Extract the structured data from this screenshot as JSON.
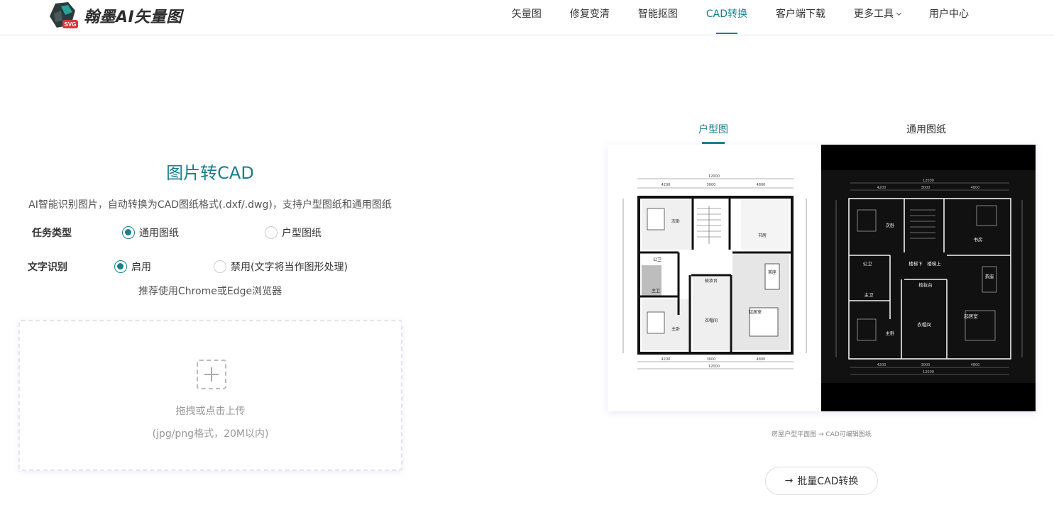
{
  "header": {
    "brand": "翰墨AI矢量图",
    "badge": "SVG",
    "nav": [
      {
        "label": "矢量图"
      },
      {
        "label": "修复变清"
      },
      {
        "label": "智能抠图"
      },
      {
        "label": "CAD转换",
        "active": true
      },
      {
        "label": "客户端下载"
      },
      {
        "label": "更多工具",
        "dropdown": true
      },
      {
        "label": "用户中心"
      }
    ]
  },
  "main": {
    "title": "图片转CAD",
    "description": "AI智能识别图片，自动转换为CAD图纸格式(.dxf/.dwg)，支持户型图纸和通用图纸",
    "task_type": {
      "label": "任务类型",
      "options": [
        "通用图纸",
        "户型图纸"
      ],
      "selected": "通用图纸"
    },
    "text_recognition": {
      "label": "文字识别",
      "options": [
        "启用",
        "禁用(文字将当作图形处理)"
      ],
      "selected": "启用"
    },
    "browser_tip": "推荐使用Chrome或Edge浏览器",
    "upload": {
      "line1": "拖拽或点击上传",
      "line2": "(jpg/png格式，20M以内)"
    }
  },
  "preview": {
    "tabs": [
      {
        "label": "户型图",
        "active": true
      },
      {
        "label": "通用图纸"
      }
    ],
    "plan": {
      "dims_top": [
        "12000",
        "4200",
        "3000",
        "4800"
      ],
      "dims_bottom": [
        "4200",
        "3000",
        "4800",
        "12000"
      ],
      "rooms_light": [
        "次卧",
        "书房",
        "公卫",
        "主卫",
        "梳妆台",
        "茶座",
        "衣帽间",
        "起居室",
        "主卧"
      ],
      "rooms_dark": [
        "次卧",
        "书房",
        "公卫",
        "楼梯下",
        "楼梯上",
        "茶座",
        "主卫",
        "梳妆台",
        "衣帽间",
        "起居室",
        "主卧"
      ]
    },
    "caption": "房屋户型平面图 → CAD可编辑图纸",
    "batch_button": "批量CAD转换"
  },
  "colors": {
    "accent": "#1a7f8e",
    "text": "#333333",
    "muted": "#999999"
  }
}
